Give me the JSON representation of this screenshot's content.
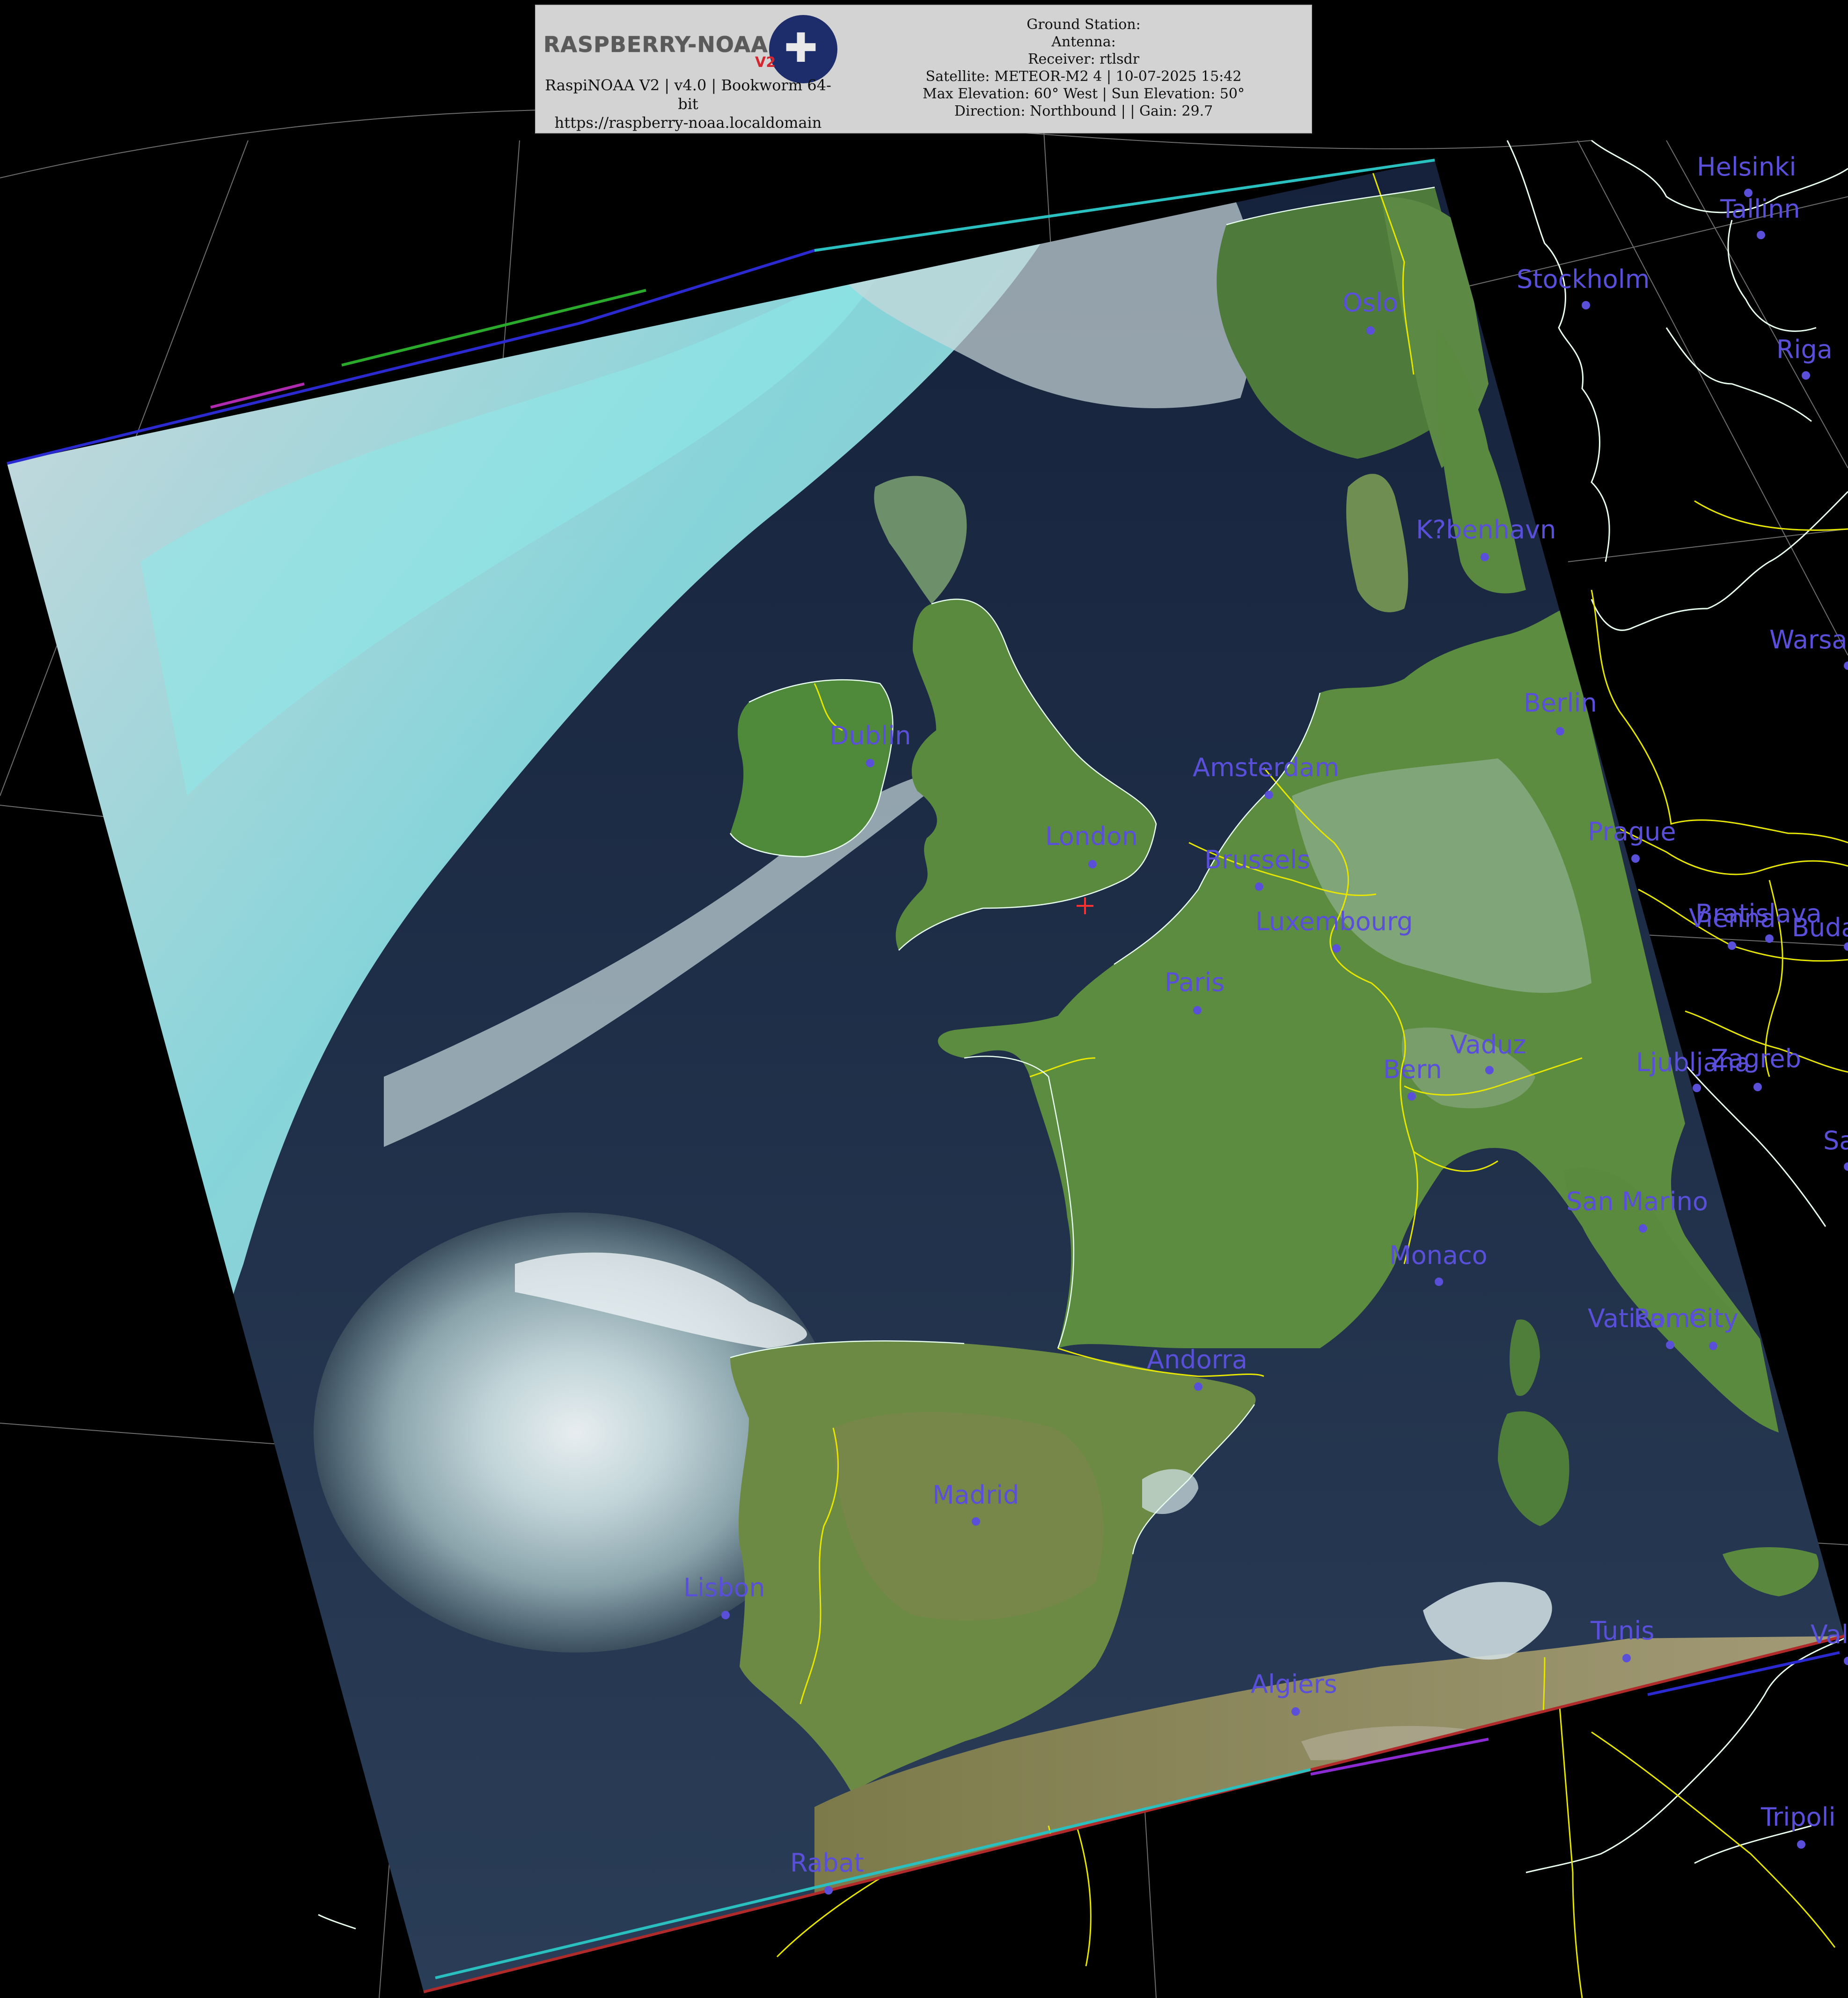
{
  "header": {
    "logo_text": "RASPBERRY-NOAA",
    "logo_version": "V2",
    "app_line": "RaspiNOAA V2 | v4.0 | Bookworm 64-bit",
    "url": "https://raspberry-noaa.localdomain",
    "ground_station": "Ground Station:",
    "antenna": "Antenna:",
    "receiver": "Receiver: rtlsdr",
    "satellite": "Satellite: METEOR-M2 4 | 10-07-2025 15:42",
    "elevation": "Max Elevation: 60° West | Sun Elevation: 50°",
    "direction": "Direction: Northbound | | Gain: 29.7"
  },
  "cities": [
    {
      "name": "Helsinki"
    },
    {
      "name": "Tallinn"
    },
    {
      "name": "Stockholm"
    },
    {
      "name": "Oslo"
    },
    {
      "name": "Riga"
    },
    {
      "name": "K?benhavn"
    },
    {
      "name": "Warsa"
    },
    {
      "name": "Berlin"
    },
    {
      "name": "Dublin"
    },
    {
      "name": "Amsterdam"
    },
    {
      "name": "London"
    },
    {
      "name": "Brussels"
    },
    {
      "name": "Prague"
    },
    {
      "name": "Luxembourg"
    },
    {
      "name": "Bratislava"
    },
    {
      "name": "Vienna"
    },
    {
      "name": "Buda"
    },
    {
      "name": "Paris"
    },
    {
      "name": "Vaduz"
    },
    {
      "name": "Ljubljana"
    },
    {
      "name": "Zagreb"
    },
    {
      "name": "Bern"
    },
    {
      "name": "Sa"
    },
    {
      "name": "San Marino"
    },
    {
      "name": "Monaco"
    },
    {
      "name": "Vatican City"
    },
    {
      "name": "Rome"
    },
    {
      "name": "Andorra"
    },
    {
      "name": "Madrid"
    },
    {
      "name": "Lisbon"
    },
    {
      "name": "Tunis"
    },
    {
      "name": "Vallet"
    },
    {
      "name": "Algiers"
    },
    {
      "name": "Tripoli"
    },
    {
      "name": "Rabat"
    }
  ],
  "colors": {
    "city_label": "#5a4fd8",
    "border": "#e6e600",
    "coast": "#e8fff0",
    "graticule": "#9a9a9a",
    "ocean": "#1a2a45",
    "land": "#5a8a3a",
    "cloud": "#cfe4e8",
    "cloud_cyan": "#7fe6e6"
  }
}
